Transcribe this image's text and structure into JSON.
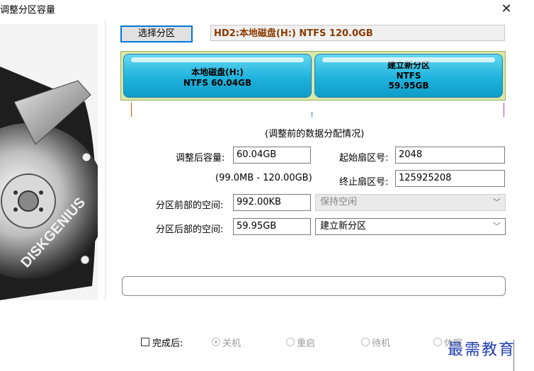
{
  "window": {
    "title": "调整分区容量",
    "close": "✕"
  },
  "sidebar": {
    "logo_text": "DISKGENIUS"
  },
  "header": {
    "select_button": "选择分区",
    "disk_info": "HD2:本地磁盘(H:) NTFS 120.0GB"
  },
  "partitions": [
    {
      "name": "本地磁盘(H:)",
      "detail": "NTFS 60.04GB"
    },
    {
      "name": "建立新分区",
      "fs": "NTFS",
      "size": "59.95GB"
    }
  ],
  "caption": "(调整前的数据分配情况)",
  "form": {
    "new_size_label": "调整后容量:",
    "new_size_value": "60.04GB",
    "range_hint": "(99.0MB - 120.00GB)",
    "start_sector_label": "起始扇区号:",
    "start_sector_value": "2048",
    "end_sector_label": "终止扇区号:",
    "end_sector_value": "125925208",
    "before_space_label": "分区前部的空间:",
    "before_space_value": "992.00KB",
    "before_space_option": "保持空闲",
    "after_space_label": "分区后部的空间:",
    "after_space_value": "59.95GB",
    "after_space_option": "建立新分区"
  },
  "after_completion": {
    "label": "完成后:",
    "options": [
      "关机",
      "重启",
      "待机",
      "休眠"
    ]
  },
  "watermark": "最需教育",
  "colors": {
    "disk_info_text": "#8b3a00",
    "partition_fill": "#1fb3dc",
    "watermark": "#1f3fb0"
  }
}
